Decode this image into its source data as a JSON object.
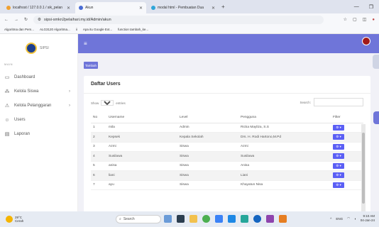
{
  "browser": {
    "tabs": [
      {
        "label": "localhost / 127.0.0.1 / sik_pelan",
        "active": false,
        "color": "#f0a030"
      },
      {
        "label": "Akun",
        "active": true,
        "color": "#4a6cd4"
      },
      {
        "label": "modal html - Pembuatan Dua",
        "active": false,
        "color": "#2fa5d8"
      }
    ],
    "new_tab": "+",
    "url": "sipsi-smkn2pelaihari.my.id/Admin/akun",
    "bookmarks": [
      "Algoritma dan Pem...",
      "ALG3120 Algoritma...",
      "ii",
      "Apa itu Google Ext...",
      "function tambah_ke..."
    ]
  },
  "sidebar": {
    "logo_text": "SIPSI",
    "menu_header": "MAIN",
    "items": [
      {
        "label": "Dashboard",
        "icon": "monitor-icon",
        "has_submenu": false
      },
      {
        "label": "Kelola Siswa",
        "icon": "users-grid-icon",
        "has_submenu": true
      },
      {
        "label": "Kelola Pelanggaran",
        "icon": "warning-icon",
        "has_submenu": true
      },
      {
        "label": "Users",
        "icon": "users-icon",
        "has_submenu": false
      },
      {
        "label": "Laporan",
        "icon": "report-icon",
        "has_submenu": false
      }
    ]
  },
  "header": {
    "accent": "#6f75d9"
  },
  "main": {
    "add_button": "Tambah",
    "card_title": "Daftar Users",
    "show_label": "Show",
    "show_value": "10",
    "entries_label": "entries",
    "search_label": "Search:",
    "columns": [
      "No",
      "Username",
      "Level",
      "Pengguna",
      "Filter"
    ],
    "rows": [
      [
        "1",
        "mila",
        "Admin",
        "Ricka Mayliza, S.S",
        ""
      ],
      [
        "2",
        "Kepsek",
        "Kepala Sekolah",
        "Drs. H. Rodi Hartono,M.Pd",
        ""
      ],
      [
        "3",
        "Azmi",
        "Siswa",
        "Azmi",
        ""
      ],
      [
        "4",
        "Susilawa",
        "Siswa",
        "Susilawa",
        ""
      ],
      [
        "5",
        "anisa",
        "Siswa",
        "Anisa",
        ""
      ],
      [
        "6",
        "liani",
        "Siswa",
        "Liani",
        ""
      ],
      [
        "7",
        "ayu",
        "Siswa",
        "Khayatun Nisa",
        ""
      ]
    ]
  },
  "taskbar": {
    "weather_temp": "29°C",
    "weather_desc": "Cerah",
    "search_placeholder": "Search",
    "lang": "ENG",
    "time": "9:10 AM",
    "date": "04-Jan-24"
  }
}
